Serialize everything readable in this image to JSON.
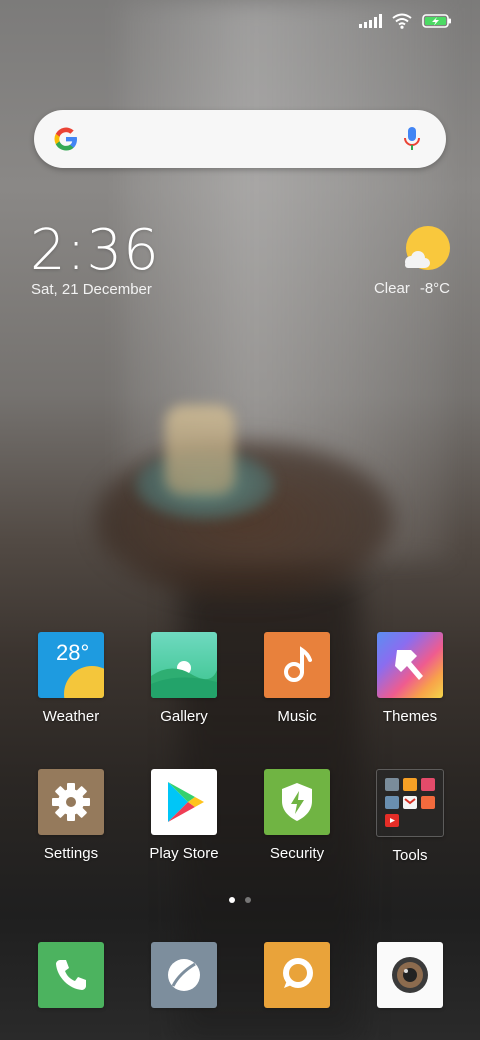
{
  "status_bar": {
    "signal": "signal-icon",
    "wifi": "wifi-icon",
    "battery": "battery-charging-icon"
  },
  "search": {
    "logo": "google-logo-icon",
    "voice": "microphone-icon"
  },
  "clock": {
    "time": "2:36",
    "date": "Sat, 21 December"
  },
  "weather": {
    "condition": "Clear",
    "temperature": "-8°C",
    "icon": "sun-cloud-icon"
  },
  "apps": [
    {
      "label": "Weather",
      "icon": "weather-icon",
      "tile_text": "28°"
    },
    {
      "label": "Gallery",
      "icon": "gallery-icon"
    },
    {
      "label": "Music",
      "icon": "music-icon"
    },
    {
      "label": "Themes",
      "icon": "themes-icon"
    },
    {
      "label": "Settings",
      "icon": "settings-icon"
    },
    {
      "label": "Play Store",
      "icon": "play-store-icon"
    },
    {
      "label": "Security",
      "icon": "security-icon"
    },
    {
      "label": "Tools",
      "icon": "tools-folder-icon"
    }
  ],
  "page_indicator": {
    "pages": 2,
    "current": 1
  },
  "dock": [
    {
      "icon": "phone-icon"
    },
    {
      "icon": "browser-icon"
    },
    {
      "icon": "messages-icon"
    },
    {
      "icon": "camera-icon"
    }
  ],
  "colors": {
    "weather_tile": "#1e9be0",
    "gallery_tile": "#44c992",
    "music_tile": "#e8813c",
    "settings_tile": "#957a5c",
    "security_tile": "#70b443",
    "phone_tile": "#4cb35f",
    "browser_tile": "#7d8e9d",
    "messages_tile": "#e9a33a"
  }
}
